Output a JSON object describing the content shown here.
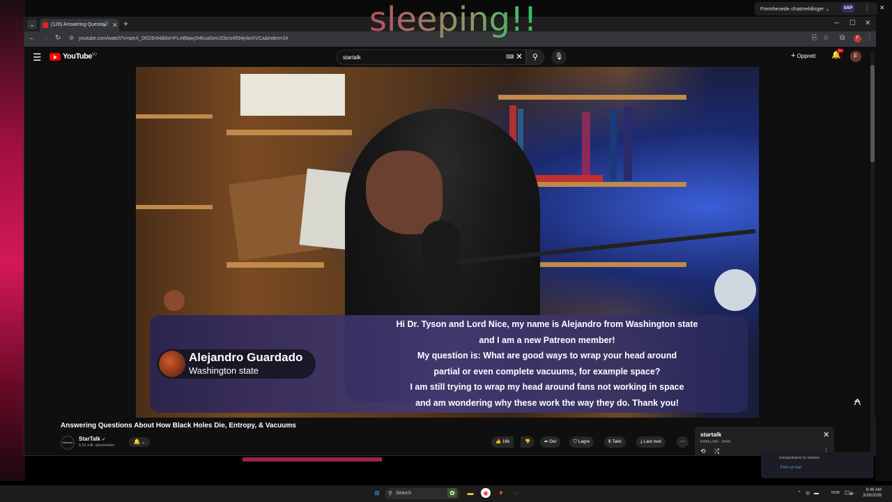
{
  "overlay": {
    "text": "sleeping!!"
  },
  "chat_widget": {
    "label": "Fremhevede chatmeldinger",
    "badge": "0XP",
    "popup_text": "retningslinjene for brukere.",
    "popup_link": "Finn ut mer"
  },
  "browser": {
    "tab_title": "(128) Answering Questio",
    "url": "youtube.com/watch?v=qmX_DO26r94&list=PLml8qwy54KzaSmUGbns4594jnlotXVCa&index=24"
  },
  "youtube": {
    "wordmark": "YouTube",
    "region": "NO",
    "search_value": "startalk",
    "create_label": "Opprett",
    "bell_badge": "9+",
    "avatar_letter": "F"
  },
  "video": {
    "guest_name": "Alejandro Guardado",
    "guest_location": "Washington state",
    "question_lines": [
      "Hi Dr. Tyson and Lord Nice, my name is Alejandro from Washington state",
      "and I am a new Patreon member!",
      "My question is: What are good ways to wrap your head around",
      "partial or even complete vacuums, for example space?",
      "I am still trying to wrap my head around fans not working in space",
      "and am wondering why these work the way they do. Thank you!"
    ],
    "title": "Answering Questions About How Black Holes Die, Entropy, & Vacuums"
  },
  "channel": {
    "name": "StarTalk",
    "subscribers": "5,51 mill. abonnenter",
    "avatar_text": "STARTALK"
  },
  "actions": {
    "likes": "16k",
    "share": "Del",
    "save": "Lagre",
    "thanks": "Takk",
    "download": "Last ned"
  },
  "playlist": {
    "title": "startalk",
    "subtitle": "FRALLOR - 24/41"
  },
  "taskbar": {
    "search_label": "Search",
    "lang": "NOB",
    "time": "8:46 AM",
    "date": "3/26/2026"
  }
}
